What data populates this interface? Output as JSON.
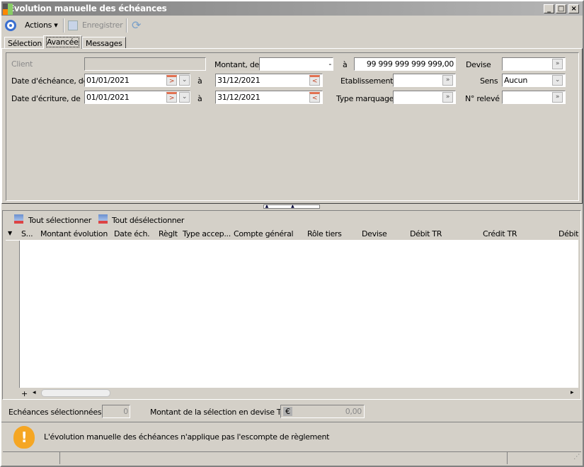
{
  "window": {
    "title": "Evolution manuelle des échéances",
    "min": "_",
    "max": "□",
    "close": "×"
  },
  "toolbar": {
    "actions": "Actions",
    "save": "Enregistrer"
  },
  "tabs": [
    "Sélection",
    "Avancée",
    "Messages"
  ],
  "form": {
    "client_label": "Client",
    "client_value": "",
    "date_ech_label": "Date d'échéance, de",
    "date_ech_from": "01/01/2021",
    "date_ech_to": "31/12/2021",
    "date_ecr_label": "Date d'écriture, de",
    "date_ecr_from": "01/01/2021",
    "date_ecr_to": "31/12/2021",
    "a_label": "à",
    "montant_label": "Montant, de",
    "montant_from": "-",
    "montant_to": "99 999 999 999 999,00",
    "devise_label": "Devise",
    "devise_value": "",
    "etab_label": "Etablissement",
    "etab_value": "",
    "sens_label": "Sens",
    "sens_value": "Aucun",
    "type_label": "Type marquage",
    "type_value": "",
    "releve_label": "N° relevé",
    "releve_value": ""
  },
  "grid": {
    "select_all": "Tout sélectionner",
    "deselect_all": "Tout désélectionner",
    "columns": [
      "S...",
      "Montant évolution",
      "Date éch.",
      "Règlt",
      "Type accep...",
      "Compte général",
      "Rôle tiers",
      "Devise",
      "Débit TR",
      "Crédit TR",
      "Débit"
    ],
    "add": "+"
  },
  "summary": {
    "count_label": "Echéances sélectionnées",
    "count": "0",
    "amount_label": "Montant de la sélection en devise TC",
    "currency": "€",
    "amount": "0,00"
  },
  "warning": "L'évolution manuelle des échéances n'applique pas l'escompte de règlement"
}
